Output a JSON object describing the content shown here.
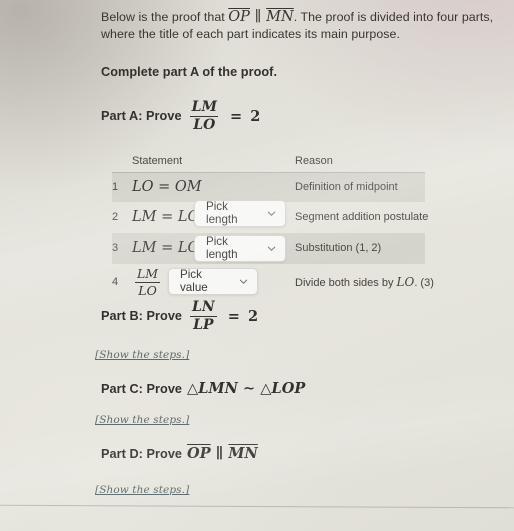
{
  "intro": {
    "line1_a": "Below is the proof that ",
    "seg_op": "OP",
    "parallel": "∥",
    "seg_mn": "MN",
    "line1_b": ". The proof is divided into four parts, where the title of each part indicates its main purpose."
  },
  "prompt": "Complete part A of the proof.",
  "parts": {
    "a": {
      "label": "Part A: Prove",
      "fraction_num": "LM",
      "fraction_den": "LO",
      "equals": "=",
      "value": "2"
    },
    "b": {
      "label": "Part B: Prove",
      "fraction_num": "LN",
      "fraction_den": "LP",
      "equals": "=",
      "value": "2",
      "steps_link": "[Show the steps.]"
    },
    "c": {
      "label": "Part C: Prove",
      "statement": "△LMN ∼ △LOP",
      "steps_link": "[Show the steps.]"
    },
    "d": {
      "label": "Part D: Prove",
      "seg_op": "OP",
      "parallel": "∥",
      "seg_mn": "MN",
      "steps_link": "[Show the steps.]"
    }
  },
  "table": {
    "headers": {
      "number": "",
      "statement": "Statement",
      "reason": "Reason"
    },
    "rows": [
      {
        "number": "1",
        "statement_text": "LO = OM",
        "reason": "Definition of midpoint",
        "dropdown": null
      },
      {
        "number": "2",
        "statement_text": "LM = LO+",
        "reason": "Segment addition postulate",
        "dropdown": {
          "value": "Pick length",
          "icon": "chevron-down-icon"
        }
      },
      {
        "number": "3",
        "statement_text": "LM = LO+",
        "reason": "Substitution (1, 2)",
        "dropdown": {
          "value": "Pick length",
          "icon": "chevron-down-icon"
        }
      },
      {
        "number": "4",
        "statement_num": "LM",
        "statement_den": "LO",
        "statement_equals": "=",
        "reason_a": "Divide both sides by ",
        "reason_math": "LO",
        "reason_b": ". (3)",
        "dropdown": {
          "value": "Pick value",
          "icon": "chevron-down-icon"
        }
      }
    ]
  },
  "colors": {
    "page_bg": "#e4e3db",
    "text": "#33312e",
    "muted_text": "#46443e",
    "row_shade": "#b0aea4",
    "dropdown_bg": "#f7f7f5",
    "dropdown_border": "#d6d5d0",
    "link": "#5d6a6d"
  }
}
